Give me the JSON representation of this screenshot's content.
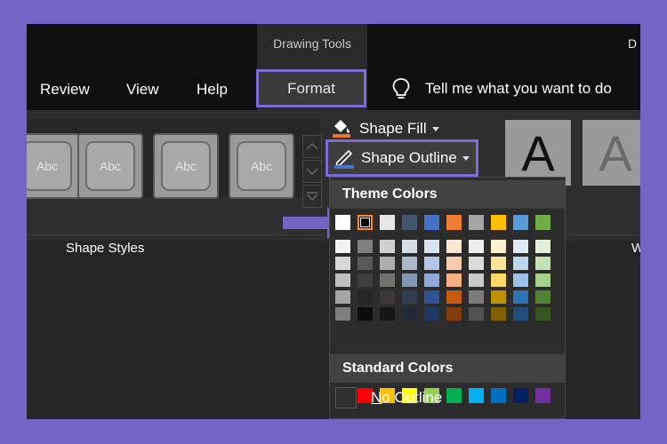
{
  "contextual_tab_title": "Drawing Tools",
  "document_title_fragment": "D",
  "tabs": {
    "review": "Review",
    "view": "View",
    "help": "Help",
    "format": "Format"
  },
  "tell_me": "Tell me what you want to do",
  "shape_styles": {
    "swatch_label": "Abc",
    "group_label": "Shape Styles"
  },
  "shape_fill_label": "Shape Fill",
  "shape_outline_label": "Shape Outline",
  "wordart": {
    "letter": "A",
    "group_label_fragment": "W"
  },
  "dropdown": {
    "theme_colors_header": "Theme Colors",
    "standard_colors_header": "Standard Colors",
    "no_outline_prefix": "N",
    "no_outline_rest": "o Outline",
    "theme_top_row": [
      "#ffffff",
      "#000000",
      "#e7e6e6",
      "#44546a",
      "#4472c4",
      "#ed7d31",
      "#a5a5a5",
      "#ffc000",
      "#5b9bd5",
      "#70ad47"
    ],
    "theme_shades": [
      [
        "#f2f2f2",
        "#d8d8d8",
        "#bfbfbf",
        "#a5a5a5",
        "#7f7f7f"
      ],
      [
        "#7f7f7f",
        "#595959",
        "#3f3f3f",
        "#262626",
        "#0c0c0c"
      ],
      [
        "#d0cece",
        "#aeabab",
        "#757171",
        "#3a3838",
        "#171616"
      ],
      [
        "#d6dce4",
        "#adb9ca",
        "#8497b0",
        "#333f4f",
        "#222a35"
      ],
      [
        "#d9e2f3",
        "#b4c6e7",
        "#8eaadb",
        "#2f5496",
        "#1f3864"
      ],
      [
        "#fbe5d5",
        "#f7cbac",
        "#f4b083",
        "#c55a11",
        "#833c0b"
      ],
      [
        "#ededed",
        "#dbdbdb",
        "#c9c9c9",
        "#7b7b7b",
        "#525252"
      ],
      [
        "#fff2cc",
        "#fee599",
        "#ffd965",
        "#bf9000",
        "#7f6000"
      ],
      [
        "#deebf6",
        "#bdd7ee",
        "#9cc3e5",
        "#2e75b5",
        "#1e4e79"
      ],
      [
        "#e2efd9",
        "#c5e0b3",
        "#a8d08d",
        "#538135",
        "#375623"
      ]
    ],
    "standard_colors": [
      "#c00000",
      "#ff0000",
      "#ffc000",
      "#ffff00",
      "#92d050",
      "#00b050",
      "#00b0f0",
      "#0070c0",
      "#002060",
      "#7030a0"
    ],
    "selected_index": 1
  },
  "colors": {
    "highlight_border": "#7c6cd4",
    "selection_border": "#ff8a2a",
    "pointer_arrow": "#7464c4"
  }
}
